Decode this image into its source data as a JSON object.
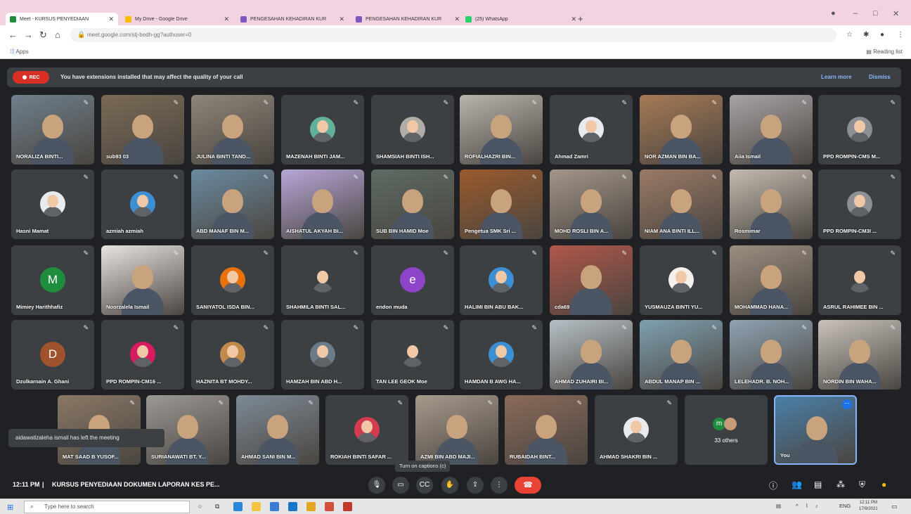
{
  "browser": {
    "tabs": [
      {
        "title": "Meet - KURSUS PENYEDIAAN",
        "color": "#1e8e3e",
        "active": true
      },
      {
        "title": "My Drive - Google Drive",
        "color": "#fbbc04",
        "active": false
      },
      {
        "title": "PENGESAHAN KEHADIRAN KUR",
        "color": "#7e57c2",
        "active": false
      },
      {
        "title": "PENGESAHAN KEHADIRAN KUR",
        "color": "#7e57c2",
        "active": false
      },
      {
        "title": "(25) WhatsApp",
        "color": "#25d366",
        "active": false
      }
    ],
    "new_tab": "+",
    "url": "meet.google.com/stj-bedh-gg?authuser=0",
    "bookmarks_apps": "Apps",
    "reading_list": "Reading list"
  },
  "banner": {
    "rec": "REC",
    "message": "You have extensions installed that may affect the quality of your call",
    "learn_more": "Learn more",
    "dismiss": "Dismiss"
  },
  "participants": [
    {
      "name": "NORALIZA BINTI...",
      "kind": "video",
      "tint": "#6f7f8c"
    },
    {
      "name": "sub93 03",
      "kind": "video",
      "tint": "#7a6a55"
    },
    {
      "name": "JULINA BINTI TAND...",
      "kind": "video",
      "tint": "#8f8579"
    },
    {
      "name": "MAZENAH BINTI JAM...",
      "kind": "avatar",
      "tint": "#62b09a"
    },
    {
      "name": "SHAMSIAH BINTI ISH...",
      "kind": "avatar",
      "tint": "#b0aca6"
    },
    {
      "name": "ROFIALHAZRI BIN...",
      "kind": "video",
      "tint": "#b9b4ad"
    },
    {
      "name": "Ahmad Zamri",
      "kind": "avatar",
      "tint": "#e8eaed"
    },
    {
      "name": "NOR AZMAN BIN BA...",
      "kind": "video",
      "tint": "#a67a55"
    },
    {
      "name": "Aiia Ismail",
      "kind": "video",
      "tint": "#a9a2a4"
    },
    {
      "name": "PPD ROMPIN-CMS M...",
      "kind": "avatar",
      "tint": "#8c8f93"
    },
    {
      "name": "Hasni Mamat",
      "kind": "avatar",
      "tint": "#e8eaed"
    },
    {
      "name": "azmiah azmiah",
      "kind": "avatar",
      "tint": "#3d8fd4"
    },
    {
      "name": "ABD MANAF BIN M...",
      "kind": "video",
      "tint": "#6b8aa0"
    },
    {
      "name": "AISHATUL AKYAH BI...",
      "kind": "video",
      "tint": "#b7a6d8"
    },
    {
      "name": "SUB BIN HAMID Moe",
      "kind": "video",
      "tint": "#5d6b63"
    },
    {
      "name": "Pengetua SMK Sri ...",
      "kind": "video",
      "tint": "#9a5a2c"
    },
    {
      "name": "MOHD ROSLI BIN A...",
      "kind": "video",
      "tint": "#a3968a"
    },
    {
      "name": "NIAM ANA BINTI ILL...",
      "kind": "video",
      "tint": "#9b7a66"
    },
    {
      "name": "Rosmimar",
      "kind": "video",
      "tint": "#c4bab0"
    },
    {
      "name": "PPD ROMPIN-CM3I ...",
      "kind": "avatar",
      "tint": "#8c8f93"
    },
    {
      "name": "Mimiey Harithhafiz",
      "kind": "letter",
      "letter": "M",
      "tint": "#1e8e3e"
    },
    {
      "name": "Noorzalela Ismail",
      "kind": "video",
      "tint": "#e9e4e0"
    },
    {
      "name": "SANIYATOL ISDA BIN...",
      "kind": "avatar",
      "tint": "#e8710a"
    },
    {
      "name": "SHAHMILA BINTI SAL...",
      "kind": "avatar",
      "tint": "#3c4043"
    },
    {
      "name": "endon muda",
      "kind": "letter",
      "letter": "e",
      "tint": "#8e44c9"
    },
    {
      "name": "HALIMI BIN ABU BAK...",
      "kind": "avatar",
      "tint": "#3d8fd4"
    },
    {
      "name": "cda69",
      "kind": "video",
      "tint": "#b0564a"
    },
    {
      "name": "YUSMAUZA BINTI YU...",
      "kind": "avatar",
      "tint": "#f4f1ea"
    },
    {
      "name": "MOHAMMAD HANA...",
      "kind": "video",
      "tint": "#9c8e80"
    },
    {
      "name": "ASRUL RAHIMEE BIN ...",
      "kind": "avatar",
      "tint": "#3c4043"
    },
    {
      "name": "Dzulkarnain A. Ghani",
      "kind": "letter",
      "letter": "D",
      "tint": "#a0522d"
    },
    {
      "name": "PPD ROMPIN-CM16 ...",
      "kind": "avatar",
      "tint": "#d81b60"
    },
    {
      "name": "HAZNITA BT MOHDY...",
      "kind": "avatar",
      "tint": "#c28a4a"
    },
    {
      "name": "HAMZAH BIN ABD H...",
      "kind": "avatar",
      "tint": "#6b7b8c"
    },
    {
      "name": "TAN LEE GEOK Moe",
      "kind": "avatar",
      "tint": "#3c4043"
    },
    {
      "name": "HAMDAN B AWG HA...",
      "kind": "avatar",
      "tint": "#3d8fd4"
    },
    {
      "name": "AHMAD ZUHAIRI BI...",
      "kind": "video",
      "tint": "#b6c0c6"
    },
    {
      "name": "ABDUL MANAP BIN ...",
      "kind": "video",
      "tint": "#7fa0b0"
    },
    {
      "name": "LELEHADR. B. NOH...",
      "kind": "video",
      "tint": "#8fa3b3"
    },
    {
      "name": "NORDIN BIN WAHA...",
      "kind": "video",
      "tint": "#c9c2bd"
    },
    {
      "name": "MAT SAAD B YUSOF...",
      "kind": "video",
      "tint": "#8a7865"
    },
    {
      "name": "SURIANAWATI BT. Y...",
      "kind": "video",
      "tint": "#9c9894"
    },
    {
      "name": "AHMAD SANI BIN M...",
      "kind": "video",
      "tint": "#7d8a95"
    },
    {
      "name": "ROKIAH BINTI SAFAR ...",
      "kind": "avatar",
      "tint": "#d33b4e"
    },
    {
      "name": "AZMI BIN ABD MAJI...",
      "kind": "video",
      "tint": "#a89a8c"
    },
    {
      "name": "RUBAIDAH BINT...",
      "kind": "video",
      "tint": "#8a6a5a"
    },
    {
      "name": "AHMAD SHAKRI BIN ...",
      "kind": "avatar",
      "tint": "#e8eaed"
    },
    {
      "name": "",
      "kind": "others",
      "tint": "#3c4043"
    },
    {
      "name": "You",
      "kind": "self",
      "tint": "#4a7fa8"
    }
  ],
  "others": {
    "avatar": "m",
    "label": "33 others"
  },
  "toast": "aidawatizaleha ismail has left the meeting",
  "tooltip": "Turn on captions (c)",
  "callbar": {
    "time": "12:11 PM",
    "meeting_title": "KURSUS PENYEDIAAN DOKUMEN LAPORAN KES PE..."
  },
  "taskbar": {
    "search_placeholder": "Type here to search",
    "lang": "ENG",
    "time": "12:11 PM",
    "date": "17/9/2021"
  }
}
